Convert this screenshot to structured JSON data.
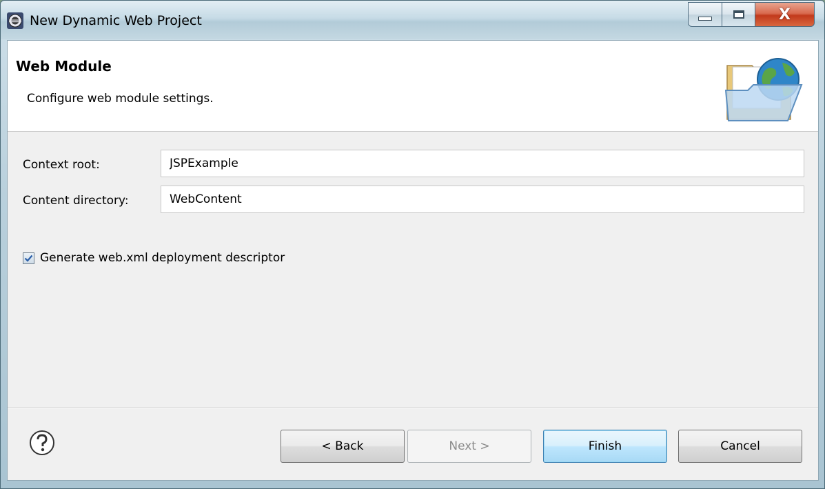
{
  "window": {
    "title": "New Dynamic Web Project",
    "icon": "eclipse-icon",
    "controls": {
      "minimize": "minimize-icon",
      "maximize": "maximize-icon",
      "close_label": "X"
    }
  },
  "banner": {
    "title": "Web Module",
    "description": "Configure web module settings.",
    "icon": "folder-globe-icon"
  },
  "form": {
    "context_root": {
      "label": "Context root:",
      "value": "JSPExample"
    },
    "content_directory": {
      "label": "Content directory:",
      "value": "WebContent"
    },
    "generate_descriptor": {
      "label": "Generate web.xml deployment descriptor",
      "checked": true
    }
  },
  "footer": {
    "help_icon": "help-icon",
    "buttons": {
      "back": "< Back",
      "next": "Next >",
      "finish": "Finish",
      "cancel": "Cancel"
    }
  },
  "colors": {
    "accent_default_button": "#3c7fb1",
    "close_button": "#c23a1c",
    "banner_background": "#ffffff",
    "dialog_background": "#f0f0f0"
  }
}
